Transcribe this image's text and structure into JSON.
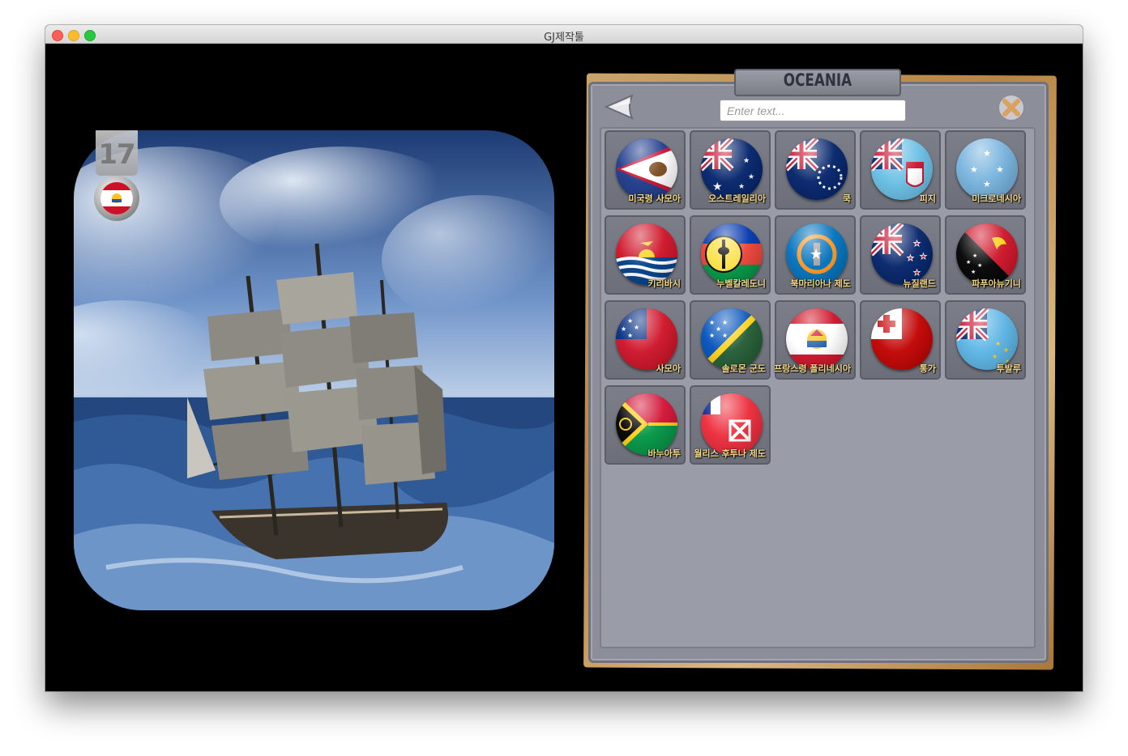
{
  "window": {
    "title": "GJ제작툴"
  },
  "level": {
    "number": "17"
  },
  "panel": {
    "title": "OCEANIA",
    "search_placeholder": "Enter text...",
    "search_value": ""
  },
  "countries": [
    {
      "name": "미국령 사모아",
      "flag": "american-samoa"
    },
    {
      "name": "오스트레일리아",
      "flag": "australia"
    },
    {
      "name": "쿡",
      "flag": "cook-islands"
    },
    {
      "name": "피지",
      "flag": "fiji"
    },
    {
      "name": "미크로네시아",
      "flag": "micronesia"
    },
    {
      "name": "키리바시",
      "flag": "kiribati"
    },
    {
      "name": "누벨칼레도니",
      "flag": "new-caledonia"
    },
    {
      "name": "북마리아나 제도",
      "flag": "northern-mariana"
    },
    {
      "name": "뉴질랜드",
      "flag": "new-zealand"
    },
    {
      "name": "파푸아뉴기니",
      "flag": "papua-new-guinea"
    },
    {
      "name": "사모아",
      "flag": "samoa"
    },
    {
      "name": "솔로몬 군도",
      "flag": "solomon-islands"
    },
    {
      "name": "프랑스령 폴리네시아",
      "flag": "french-polynesia"
    },
    {
      "name": "통가",
      "flag": "tonga"
    },
    {
      "name": "투발루",
      "flag": "tuvalu"
    },
    {
      "name": "바누아투",
      "flag": "vanuatu"
    },
    {
      "name": "월리스 후투나 제도",
      "flag": "wallis-futuna"
    }
  ],
  "icons": {
    "back": "back-arrow-icon",
    "close": "close-icon"
  }
}
